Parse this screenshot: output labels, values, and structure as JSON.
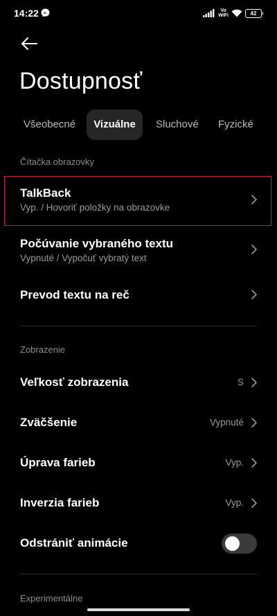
{
  "status_bar": {
    "time": "14:22",
    "volte_line1": "Vo",
    "volte_line2": "WiFi",
    "battery": "42"
  },
  "header": {
    "title": "Dostupnosť"
  },
  "tabs": [
    {
      "label": "Všeobecné",
      "active": false
    },
    {
      "label": "Vizuálne",
      "active": true
    },
    {
      "label": "Sluchové",
      "active": false
    },
    {
      "label": "Fyzické",
      "active": false
    }
  ],
  "sections": {
    "screen_reader": {
      "header": "Čítačka obrazovky",
      "items": [
        {
          "title": "TalkBack",
          "subtitle": "Vyp. / Hovoriť položky na obrazovke"
        },
        {
          "title": "Počúvanie vybraného textu",
          "subtitle": "Vypnuté / Vypočuť vybratý text"
        },
        {
          "title": "Prevod textu na reč"
        }
      ]
    },
    "display": {
      "header": "Zobrazenie",
      "items": [
        {
          "title": "Veľkosť zobrazenia",
          "value": "S"
        },
        {
          "title": "Zväčšenie",
          "value": "Vypnuté"
        },
        {
          "title": "Úprava farieb",
          "value": "Vyp."
        },
        {
          "title": "Inverzia farieb",
          "value": "Vyp."
        },
        {
          "title": "Odstrániť animácie",
          "toggle": false
        }
      ]
    },
    "experimental": {
      "header": "Experimentálne"
    }
  },
  "colors": {
    "background": "#000000",
    "highlight_border": "#c8223a",
    "active_tab_bg": "#262626",
    "secondary_text": "#9a9a9a"
  },
  "icons": [
    "messenger-icon",
    "signal-icon",
    "wifi-icon",
    "battery-icon",
    "back-arrow-icon",
    "chevron-right-icon"
  ]
}
